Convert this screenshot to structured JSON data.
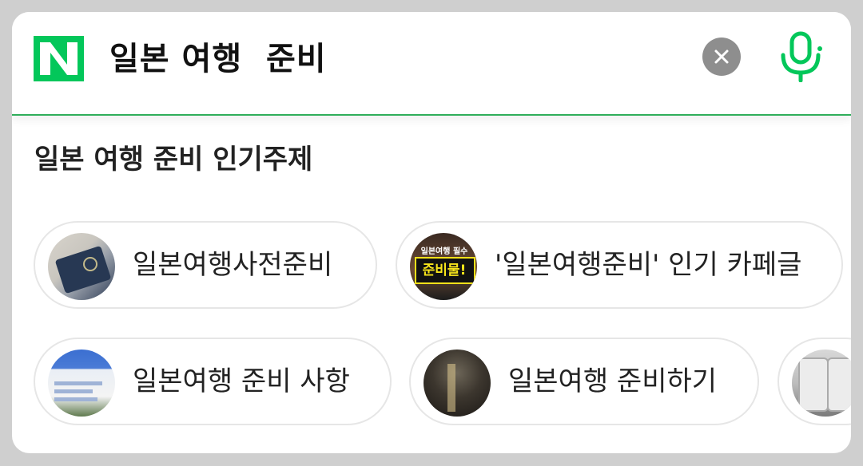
{
  "search": {
    "query": "일본 여행  준비",
    "logo_letter": "N",
    "clear_icon": "close-icon",
    "mic_icon": "microphone-icon",
    "brand_color": "#03c75a"
  },
  "section": {
    "title": "일본 여행 준비 인기주제"
  },
  "chips_row1": [
    {
      "label": "일본여행사전준비",
      "thumb": "passport-photo"
    },
    {
      "label": "'일본여행준비' 인기 카페글",
      "thumb": "cafe-post-photo",
      "thumb_top_text": "일본여행 필수",
      "thumb_text": "준비물!"
    }
  ],
  "chips_row2": [
    {
      "label": "일본여행 준비 사항",
      "thumb": "checklist-screenshot"
    },
    {
      "label": "일본여행 준비하기",
      "thumb": "night-street-photo"
    },
    {
      "label": "",
      "thumb": "suitcase-photo"
    }
  ]
}
